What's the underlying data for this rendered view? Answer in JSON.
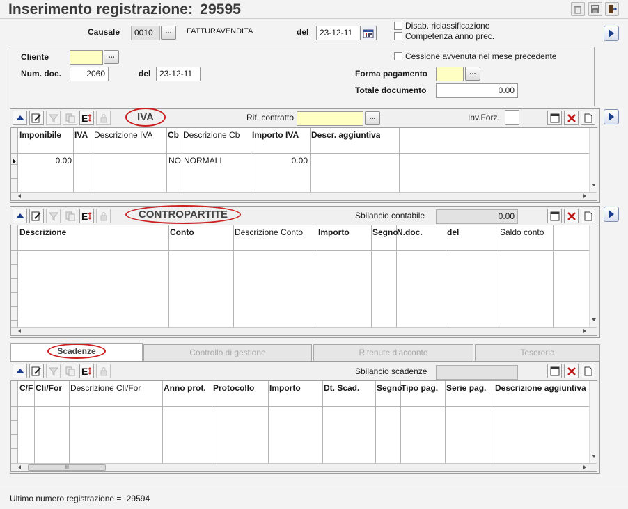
{
  "window": {
    "title": "Inserimento registrazione:",
    "reg_number": "29595"
  },
  "header": {
    "causale_label": "Causale",
    "causale_code": "0010",
    "causale_button": "...",
    "causale_desc": "FATTURAVENDITA",
    "del_label": "del",
    "del_value": "23-12-11",
    "disab_label": "Disab. riclassificazione",
    "competenza_label": "Competenza anno prec."
  },
  "client": {
    "cliente_label": "Cliente",
    "cliente_value": "",
    "cliente_button": "...",
    "cessione_label": "Cessione avvenuta nel mese precedente",
    "num_doc_label": "Num. doc.",
    "num_doc_value": "2060",
    "del_label": "del",
    "del_value": "23-12-11",
    "forma_label": "Forma pagamento",
    "forma_value": "",
    "forma_button": "...",
    "totale_label": "Totale documento",
    "totale_value": "0.00"
  },
  "iva": {
    "title": "IVA",
    "rif_label": "Rif. contratto",
    "rif_value": "",
    "rif_button": "...",
    "invforz_label": "Inv.Forz.",
    "columns": [
      "Imponibile",
      "IVA",
      "Descrizione IVA",
      "Cb",
      "Descrizione Cb",
      "Importo IVA",
      "Descr. aggiuntiva"
    ],
    "rows": [
      {
        "imponibile": "0.00",
        "iva": "",
        "descr_iva": "",
        "cb": "NO",
        "descr_cb": "NORMALI",
        "importo_iva": "0.00",
        "descr_agg": ""
      }
    ]
  },
  "contropartite": {
    "title": "CONTROPARTITE",
    "sbilancio_label": "Sbilancio contabile",
    "sbilancio_value": "0.00",
    "columns": [
      "Descrizione",
      "Conto",
      "Descrizione Conto",
      "Importo",
      "Segno",
      "N.doc.",
      "del",
      "Saldo conto"
    ]
  },
  "tabs": [
    {
      "label": "Scadenze",
      "active": true
    },
    {
      "label": "Controllo di gestione",
      "active": false
    },
    {
      "label": "Ritenute d'acconto",
      "active": false
    },
    {
      "label": "Tesoreria",
      "active": false
    }
  ],
  "scadenze": {
    "sbilancio_label": "Sbilancio scadenze",
    "sbilancio_value": "",
    "columns": [
      "C/F",
      "Cli/For",
      "Descrizione Cli/For",
      "Anno prot.",
      "Protocollo",
      "Importo",
      "Dt. Scad.",
      "Segno",
      "Tipo pag.",
      "Serie pag.",
      "Descrizione aggiuntiva"
    ],
    "scroll_thumb": "III"
  },
  "status": {
    "text": "Ultimo numero registrazione =",
    "value": "29594"
  },
  "colors": {
    "accent_blue": "#1a3a8a",
    "highlight_red": "#cc2020",
    "field_yellow": "#ffffc4"
  },
  "icons": {
    "toolbar": [
      "trash-icon",
      "save-icon",
      "exit-icon"
    ],
    "grid_toolbar": [
      "up-arrow-icon",
      "edit-icon",
      "filter-icon",
      "copy-icon",
      "export-icon",
      "lock-icon"
    ],
    "grid_right": [
      "window-icon",
      "delete-icon",
      "new-document-icon"
    ]
  }
}
